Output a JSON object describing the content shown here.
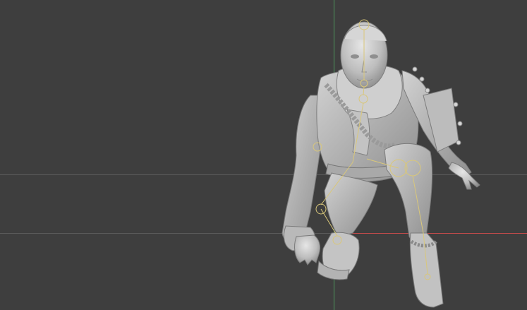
{
  "viewport": {
    "background_color": "#3e3e3e",
    "axis_colors": {
      "x": "#c24b4b",
      "y": "#4fa061",
      "grid": "#5b5b5b"
    },
    "model_color": "#c9c9c9",
    "joint_color": "#d9c77a"
  }
}
